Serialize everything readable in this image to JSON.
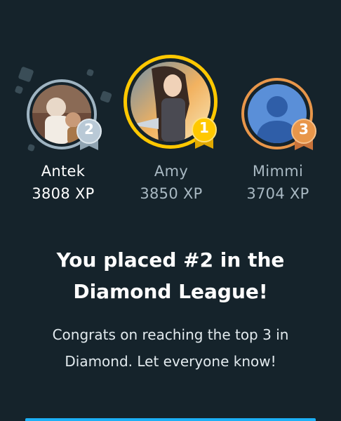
{
  "podium": [
    {
      "name": "Antek",
      "xp": "3808 XP",
      "rank": "2",
      "medal_color": "#b9c9d6",
      "ring_color": "#9fb4c2",
      "highlighted": false
    },
    {
      "name": "Amy",
      "xp": "3850 XP",
      "rank": "1",
      "medal_color": "#ffc800",
      "ring_color": "#ffc800",
      "highlighted": true
    },
    {
      "name": "Mimmi",
      "xp": "3704 XP",
      "rank": "3",
      "medal_color": "#e8964a",
      "ring_color": "#e8964a",
      "highlighted": false
    }
  ],
  "headline": {
    "line1": "You placed #2 in the",
    "line2": "Diamond League!"
  },
  "message": {
    "line1": "Congrats on reaching the top 3 in",
    "line2": "Diamond. Let everyone know!"
  },
  "colors": {
    "background": "#15232b",
    "primary_text": "#ffffff",
    "muted_text": "#a8b8c2",
    "accent_blue": "#1cb0f6"
  }
}
